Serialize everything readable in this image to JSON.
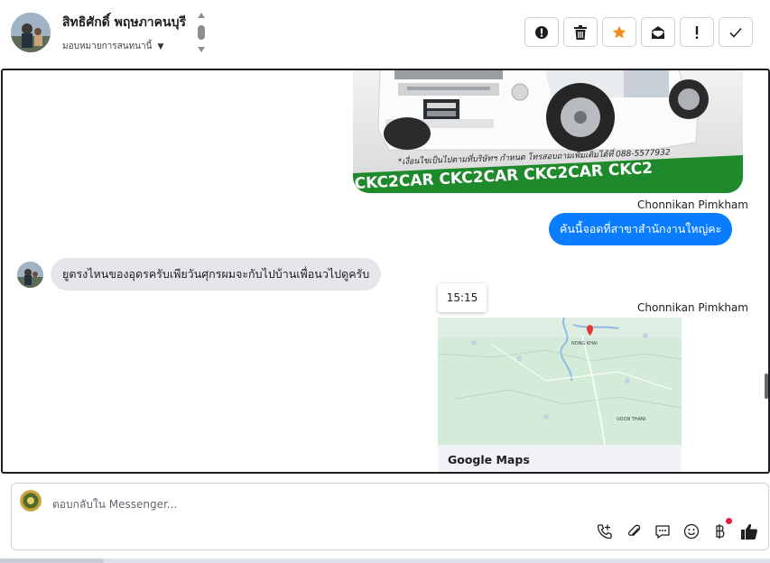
{
  "header": {
    "contact_name": "สิทธิศักดิ์ พฤษภาคนบุรี",
    "assign_label": "มอบหมายการสนทนานี้",
    "toolbar": [
      {
        "name": "report-spam-button",
        "icon": "alert-circle-icon"
      },
      {
        "name": "delete-button",
        "icon": "trash-icon"
      },
      {
        "name": "star-button",
        "icon": "star-icon"
      },
      {
        "name": "mark-unread-button",
        "icon": "envelope-icon"
      },
      {
        "name": "follow-up-button",
        "icon": "exclamation-icon"
      },
      {
        "name": "mark-done-button",
        "icon": "check-icon"
      }
    ]
  },
  "conversation": {
    "car_image": {
      "banner_note": "*เงื่อนไขเป็นไปตามที่บริษัทฯ กำหนด โทรสอบถามเพิ่มเติมได้ที่ 088-5577932",
      "banner_text": "CKC2CAR CKC2CAR CKC2CAR CKC2"
    },
    "sender_1": "Chonnikan Pimkham",
    "outgoing_message": "คันนี้จอดที่สาขาสำนักงานใหญ่คะ",
    "incoming_message": "ยูตรงไหนของอุดรครับเพียวันศุกรผมจะกับไปบ้านเพื่อนวไปดูครับ",
    "timestamp": "15:15",
    "sender_2": "Chonnikan Pimkham",
    "map": {
      "city_label": "NONG KHAI",
      "city_label_2": "UDON THANI",
      "caption": "Google Maps"
    }
  },
  "composer": {
    "placeholder": "ตอบกลับใน Messenger...",
    "icons": [
      "phone-add-icon",
      "paperclip-icon",
      "chat-bubble-icon",
      "emoji-icon",
      "baht-icon",
      "thumbs-up-icon"
    ]
  },
  "colors": {
    "accent_blue": "#0a7cff",
    "star_orange": "#f28b21",
    "incoming_bubble": "#e4e6eb",
    "banner_green": "#1f8a2b"
  }
}
